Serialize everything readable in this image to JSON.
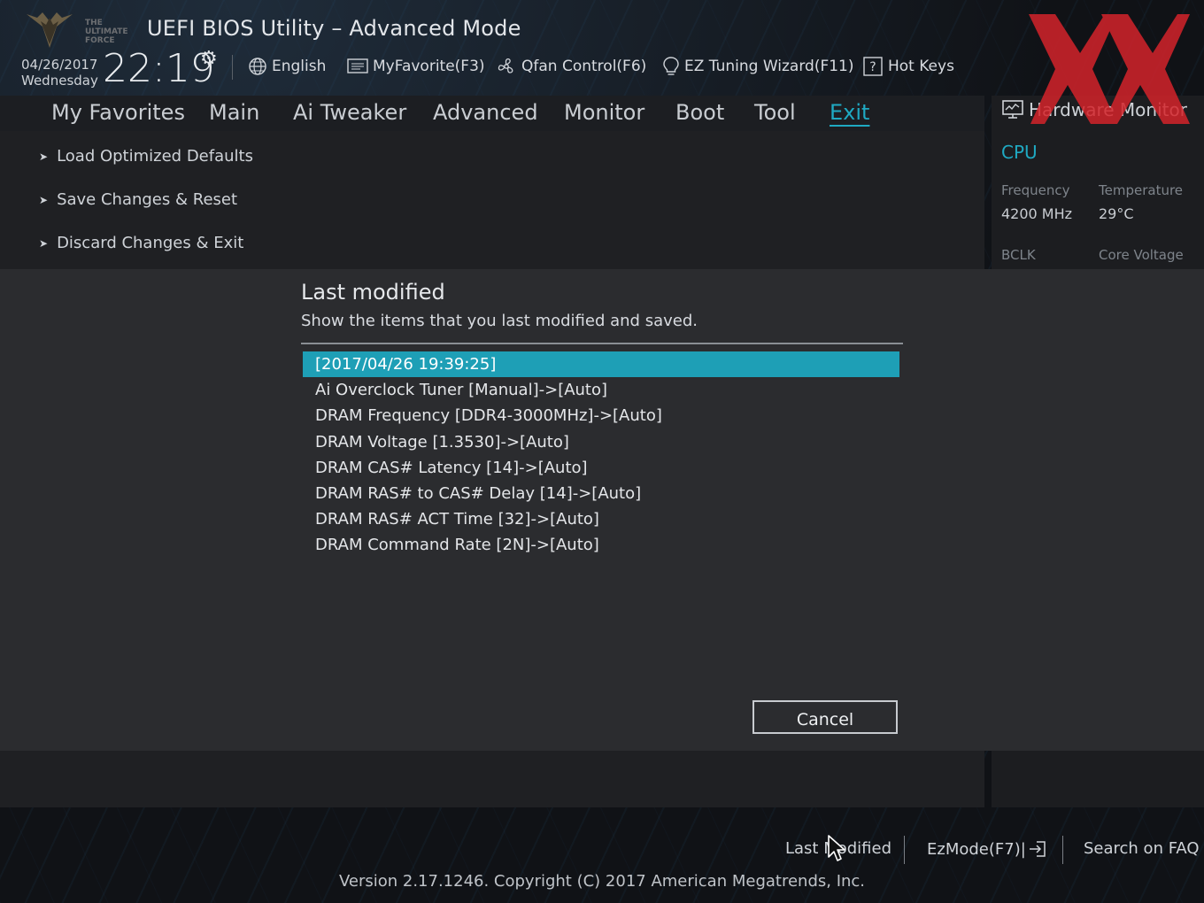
{
  "header": {
    "logo_text": [
      "THE",
      "ULTIMATE",
      "FORCE"
    ],
    "title": "UEFI BIOS Utility – Advanced Mode",
    "date": "04/26/2017",
    "day": "Wednesday",
    "time": "22:19",
    "toolbar": [
      {
        "label": "English",
        "icon": "globe-icon"
      },
      {
        "label": "MyFavorite(F3)",
        "icon": "favorite-list-icon"
      },
      {
        "label": "Qfan Control(F6)",
        "icon": "fan-icon"
      },
      {
        "label": "EZ Tuning Wizard(F11)",
        "icon": "lightbulb-icon"
      },
      {
        "label": "Hot Keys",
        "icon": "help-icon"
      }
    ]
  },
  "tabs": [
    {
      "label": "My Favorites"
    },
    {
      "label": "Main"
    },
    {
      "label": "Ai Tweaker"
    },
    {
      "label": "Advanced"
    },
    {
      "label": "Monitor"
    },
    {
      "label": "Boot"
    },
    {
      "label": "Tool"
    },
    {
      "label": "Exit",
      "active": true
    }
  ],
  "exit_menu": [
    {
      "label": "Load Optimized Defaults"
    },
    {
      "label": "Save Changes & Reset"
    },
    {
      "label": "Discard Changes & Exit"
    }
  ],
  "hw_monitor": {
    "title": "Hardware Monitor",
    "section": "CPU",
    "freq_label": "Frequency",
    "freq_value": "4200 MHz",
    "temp_label": "Temperature",
    "temp_value": "29°C",
    "bclk_label": "BCLK",
    "vcore_label": "Core Voltage"
  },
  "dialog": {
    "title": "Last modified",
    "description": "Show the items that you last modified and saved.",
    "items": [
      "[2017/04/26 19:39:25]",
      "Ai Overclock Tuner [Manual]->[Auto]",
      "DRAM Frequency [DDR4-3000MHz]->[Auto]",
      "DRAM Voltage [1.3530]->[Auto]",
      "DRAM CAS# Latency [14]->[Auto]",
      "DRAM RAS# to CAS# Delay [14]->[Auto]",
      "DRAM RAS# ACT Time [32]->[Auto]",
      "DRAM Command Rate [2N]->[Auto]"
    ],
    "cancel_label": "Cancel"
  },
  "footer": {
    "last_modified": "Last Modified",
    "ezmode": "EzMode(F7)|",
    "search_faq": "Search on FAQ",
    "version": "Version 2.17.1246. Copyright (C) 2017 American Megatrends, Inc."
  },
  "colors": {
    "accent": "#1fa9c2",
    "selection": "#1e9fb6",
    "watermark": "#d3232a"
  }
}
